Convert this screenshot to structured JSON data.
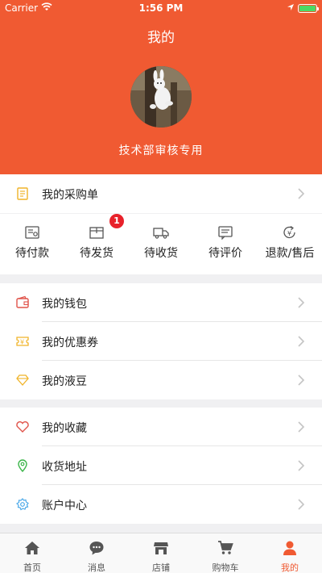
{
  "status_bar": {
    "carrier": "Carrier",
    "time": "1:56 PM"
  },
  "header": {
    "title": "我的",
    "username": "技术部审核专用"
  },
  "purchase": {
    "label": "我的采购单"
  },
  "orders": [
    {
      "label": "待付款",
      "icon": "pay-icon"
    },
    {
      "label": "待发货",
      "icon": "box-icon",
      "badge": "1"
    },
    {
      "label": "待收货",
      "icon": "truck-icon"
    },
    {
      "label": "待评价",
      "icon": "comment-icon"
    },
    {
      "label": "退款/售后",
      "icon": "refund-icon"
    }
  ],
  "group1": [
    {
      "label": "我的钱包",
      "icon": "wallet-icon"
    },
    {
      "label": "我的优惠券",
      "icon": "coupon-icon"
    },
    {
      "label": "我的液豆",
      "icon": "diamond-icon"
    }
  ],
  "group2": [
    {
      "label": "我的收藏",
      "icon": "heart-icon"
    },
    {
      "label": "收货地址",
      "icon": "location-icon"
    },
    {
      "label": "账户中心",
      "icon": "gear-icon"
    }
  ],
  "tabs": [
    {
      "label": "首页",
      "icon": "home-icon"
    },
    {
      "label": "消息",
      "icon": "message-icon"
    },
    {
      "label": "店铺",
      "icon": "store-icon"
    },
    {
      "label": "购物车",
      "icon": "cart-icon"
    },
    {
      "label": "我的",
      "icon": "person-icon",
      "active": true
    }
  ],
  "colors": {
    "accent": "#f05a32",
    "badge": "#e8212a",
    "battery": "#4cd964"
  }
}
